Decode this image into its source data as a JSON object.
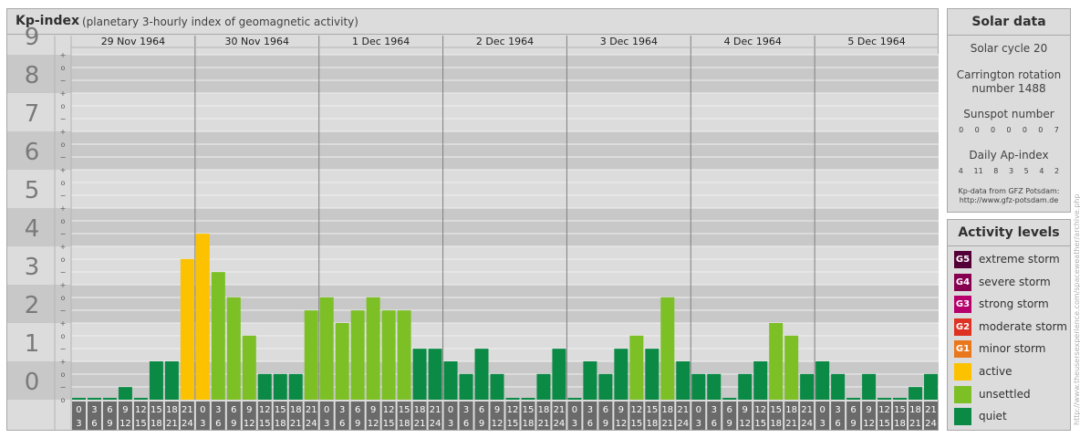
{
  "header": {
    "title": "Kp-index",
    "subtitle": "(planetary 3-hourly index of geomagnetic activity)"
  },
  "chart_data": {
    "type": "bar",
    "y_axis": {
      "range": [
        0,
        9
      ],
      "major_ticks": [
        "0",
        "1",
        "2",
        "3",
        "4",
        "5",
        "6",
        "7",
        "8",
        "9"
      ],
      "minor_ticks": [
        "+",
        "o",
        "−"
      ]
    },
    "days": [
      "29 Nov 1964",
      "30 Nov 1964",
      "1 Dec 1964",
      "2 Dec 1964",
      "3 Dec 1964",
      "4 Dec 1964",
      "5 Dec 1964"
    ],
    "interval_top_labels": [
      "0",
      "3",
      "6",
      "9",
      "12",
      "15",
      "18",
      "21"
    ],
    "interval_bottom_labels": [
      "3",
      "6",
      "9",
      "12",
      "15",
      "18",
      "21",
      "24"
    ],
    "values": [
      0,
      0,
      0,
      0.33,
      0,
      1,
      1,
      3.67,
      4.33,
      3.33,
      2.67,
      1.67,
      0.67,
      0.67,
      0.67,
      2.33,
      2.67,
      2,
      2.33,
      2.67,
      2.33,
      2.33,
      1.33,
      1.33,
      1,
      0.67,
      1.33,
      0.67,
      0,
      0,
      0.67,
      1.33,
      0,
      1,
      0.67,
      1.33,
      1.67,
      1.33,
      2.67,
      1,
      0.67,
      0.67,
      0,
      0.67,
      1,
      2,
      1.67,
      0.67,
      1,
      0.67,
      0,
      0.67,
      0,
      0,
      0.33,
      0.67
    ],
    "grid": true,
    "colors": {
      "quiet": "#0a8a45",
      "unsettled": "#7cc025",
      "active": "#fcc200"
    }
  },
  "solar_data": {
    "title": "Solar data",
    "cycle": "Solar cycle 20",
    "carrington_line1": "Carrington rotation",
    "carrington_line2": "number 1488",
    "sunspot_title": "Sunspot number",
    "sunspot_values": [
      "0",
      "0",
      "0",
      "0",
      "0",
      "0",
      "7"
    ],
    "ap_title": "Daily Ap-index",
    "ap_values": [
      "4",
      "11",
      "8",
      "3",
      "5",
      "4",
      "2"
    ],
    "credit_line1": "Kp-data from GFZ Potsdam:",
    "credit_line2": "http://www.gfz-potsdam.de"
  },
  "activity_levels": {
    "title": "Activity levels",
    "items": [
      {
        "badge": "G5",
        "label": "extreme storm",
        "color": "#520037"
      },
      {
        "badge": "G4",
        "label": "severe storm",
        "color": "#86004f"
      },
      {
        "badge": "G3",
        "label": "strong storm",
        "color": "#b6006b"
      },
      {
        "badge": "G2",
        "label": "moderate storm",
        "color": "#de3223"
      },
      {
        "badge": "G1",
        "label": "minor storm",
        "color": "#e9781d"
      },
      {
        "badge": "",
        "label": "active",
        "color": "#fcc200"
      },
      {
        "badge": "",
        "label": "unsettled",
        "color": "#7cc025"
      },
      {
        "badge": "",
        "label": "quiet",
        "color": "#0a8a45"
      }
    ]
  },
  "watermark": "http://www.theusersexperience.com/spaceweather/archive.php"
}
